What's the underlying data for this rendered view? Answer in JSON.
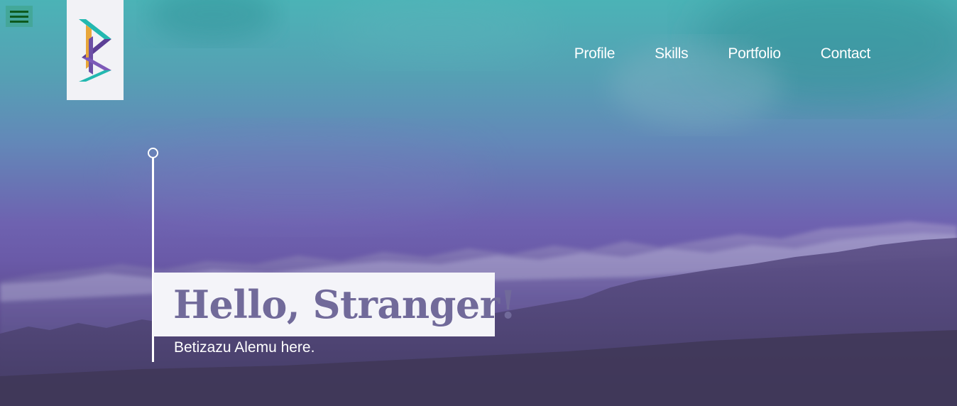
{
  "header": {
    "menu_toggle_icon": "hamburger-menu-icon",
    "logo": {
      "letter": "B",
      "colors": [
        "#23b8b0",
        "#6c4fa6",
        "#e8a63a"
      ]
    }
  },
  "nav": {
    "items": [
      {
        "label": "Profile"
      },
      {
        "label": "Skills"
      },
      {
        "label": "Portfolio"
      },
      {
        "label": "Contact"
      }
    ]
  },
  "hero": {
    "greeting": "Hello, Stranger!",
    "subtitle": "Betizazu Alemu here."
  },
  "colors": {
    "sky_top": "#4bb3b6",
    "sky_mid": "#6e62b0",
    "ground": "#4a3f6d",
    "greeting_text": "#716a9a",
    "card_bg": "#f4f4f9"
  }
}
